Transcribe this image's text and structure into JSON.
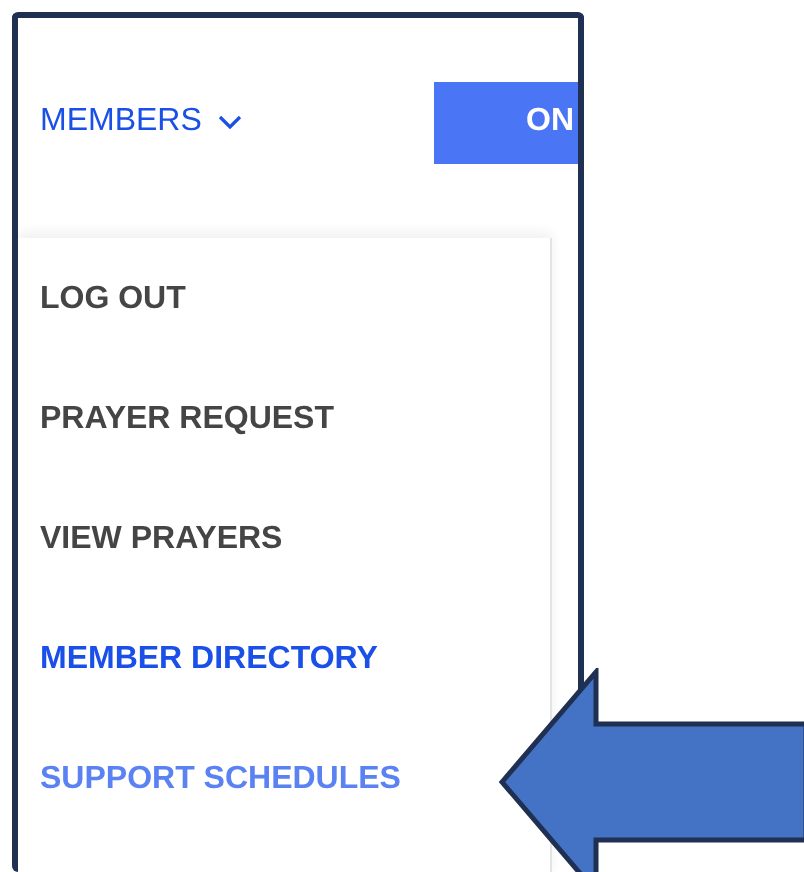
{
  "nav": {
    "menu_label": "MEMBERS",
    "expanded": true,
    "button": "ON"
  },
  "dropdown": [
    {
      "label": "LOG OUT",
      "selected": false,
      "hovered": false
    },
    {
      "label": "PRAYER REQUEST",
      "selected": false,
      "hovered": false
    },
    {
      "label": "VIEW PRAYERS",
      "selected": false,
      "hovered": false
    },
    {
      "label": "MEMBER DIRECTORY",
      "selected": true,
      "hovered": false
    },
    {
      "label": "SUPPORT SCHEDULES",
      "selected": false,
      "hovered": true
    }
  ]
}
